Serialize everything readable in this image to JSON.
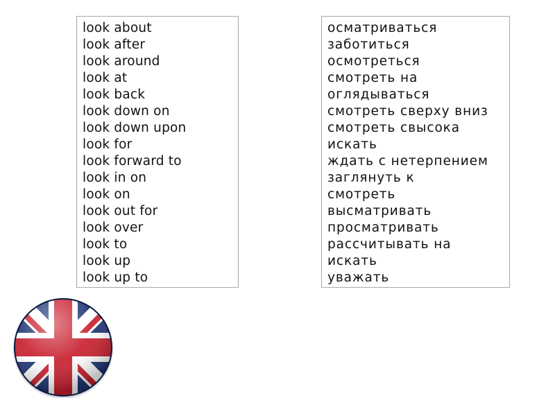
{
  "english": {
    "items": [
      "look about",
      "look after",
      "look around",
      "look at",
      "look back",
      "look down on",
      "look down upon",
      "look for",
      "look forward to",
      "look in on",
      "look on",
      "look out for",
      "look over",
      "look to",
      "look up",
      "look up to"
    ]
  },
  "russian": {
    "items": [
      "осматриваться",
      "заботиться",
      "осмотреться",
      "смотреть на",
      "оглядываться",
      "смотреть сверху вниз",
      "смотреть свысока",
      "искать",
      "ждать с нетерпением",
      "заглянуть к",
      "смотреть",
      "высматривать",
      "просматривать",
      "рассчитывать на",
      "искать",
      "уважать"
    ]
  },
  "flag": {
    "icon": "uk-flag-icon",
    "colors": {
      "blue": "#1f3575",
      "red": "#c8202f",
      "white": "#ffffff"
    }
  }
}
